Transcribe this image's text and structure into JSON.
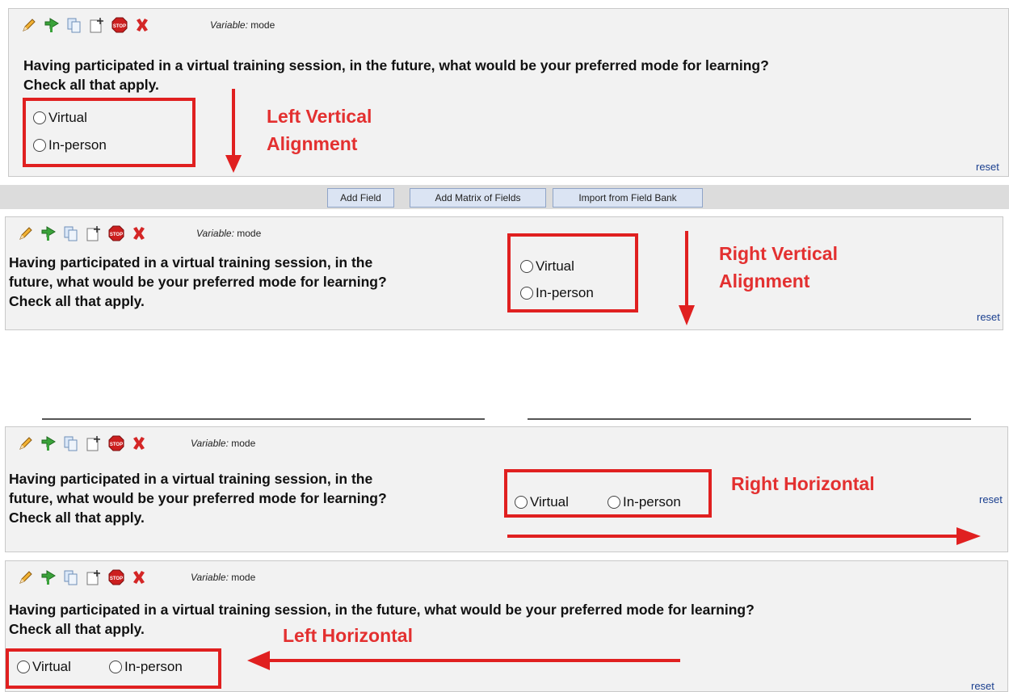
{
  "variable_prefix": "Variable:",
  "variable_name": "mode",
  "question_full": "Having participated in a virtual training session, in the future, what would be your preferred mode for learning?",
  "question_line2": "Check all that apply.",
  "question_narrow_l1": "Having participated in a virtual training session, in the",
  "question_narrow_l2": "future, what would be your preferred mode for learning?",
  "options": [
    "Virtual",
    "In-person"
  ],
  "reset_label": "reset",
  "buttons": {
    "add_field": "Add Field",
    "add_matrix": "Add Matrix of Fields",
    "import_bank": "Import from Field Bank"
  },
  "annotations": {
    "left_vertical_1": "Left  Vertical",
    "left_vertical_2": "Alignment",
    "right_vertical_1": "Right Vertical",
    "right_vertical_2": "Alignment",
    "right_horizontal": "Right Horizontal",
    "left_horizontal": "Left Horizontal"
  },
  "icons": [
    "pencil-icon",
    "branching-icon",
    "copy-icon",
    "move-icon",
    "stop-icon",
    "delete-icon"
  ],
  "colors": {
    "annotation": "#e02020",
    "reset_link": "#1a3f8f",
    "button_bg": "#dbe4f3"
  }
}
